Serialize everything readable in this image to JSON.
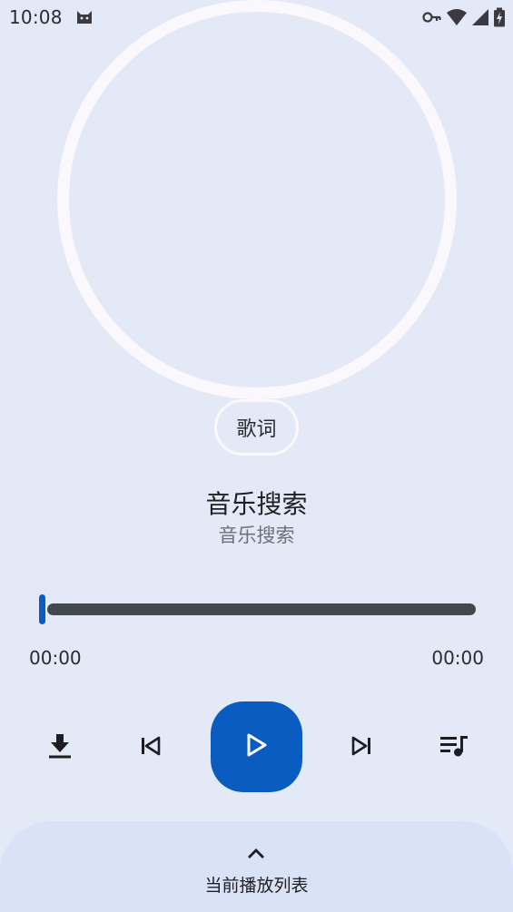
{
  "status_bar": {
    "time": "10:08",
    "app_icon": "cat-icon",
    "indicators": [
      "vpn-key-icon",
      "wifi-icon",
      "cellular-signal-icon",
      "battery-charging-icon"
    ]
  },
  "player": {
    "lyrics_label": "歌词",
    "title": "音乐搜索",
    "artist": "音乐搜索",
    "progress": {
      "fraction": 0.0,
      "elapsed": "00:00",
      "total": "00:00"
    },
    "controls": [
      {
        "name": "download",
        "icon": "download-icon"
      },
      {
        "name": "previous",
        "icon": "skip-previous-icon"
      },
      {
        "name": "play",
        "icon": "play-icon"
      },
      {
        "name": "next",
        "icon": "skip-next-icon"
      },
      {
        "name": "queue",
        "icon": "queue-music-icon"
      }
    ]
  },
  "bottom_sheet": {
    "icon": "chevron-up-icon",
    "label": "当前播放列表"
  },
  "colors": {
    "background": "#e3e9f6",
    "accent": "#0b5cc0",
    "ring": "#fbf8fd",
    "track": "#45474f",
    "sheet": "#dae2f7"
  }
}
